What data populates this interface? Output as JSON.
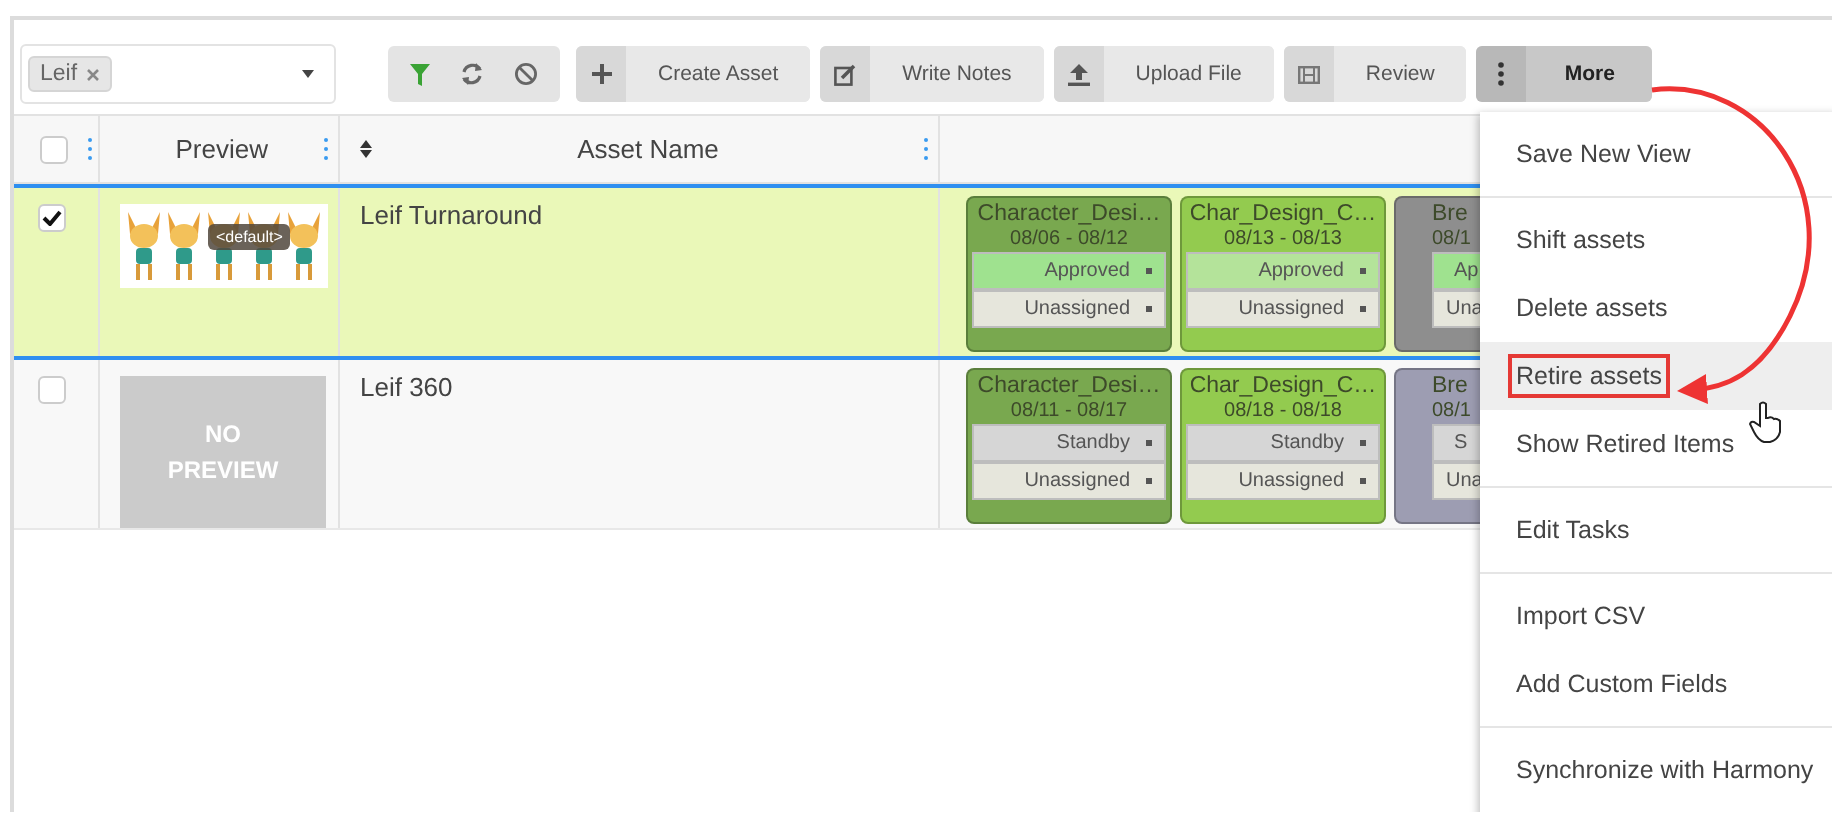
{
  "filter": {
    "tags": [
      {
        "label": "Leif"
      }
    ]
  },
  "toolbar": {
    "buttons": [
      {
        "label": "Create Asset",
        "active": false
      },
      {
        "label": "Write Notes",
        "active": false
      },
      {
        "label": "Upload File",
        "active": false
      },
      {
        "label": "Review",
        "active": false
      },
      {
        "label": "More",
        "active": true
      }
    ]
  },
  "table": {
    "header_checked": false,
    "columns": [
      {
        "label": "Preview"
      },
      {
        "label": "Asset Name"
      }
    ],
    "rows": [
      {
        "selected": true,
        "checked": true,
        "preview": {
          "kind": "picture",
          "badge": "<default>"
        },
        "name": "Leif Turnaround",
        "tasks": [
          {
            "title": "Character_Desi…",
            "dates": "08/06 - 08/12",
            "status": {
              "label": "Approved",
              "color": "#9fe28f"
            },
            "assignee": "Unassigned",
            "color": "#79a84f"
          },
          {
            "title": "Char_Design_C…",
            "dates": "08/13 - 08/13",
            "status": {
              "label": "Approved",
              "color": "#b4e39a"
            },
            "assignee": "Unassigned",
            "color": "#93cb4f"
          },
          {
            "title": "Bre",
            "dates": "08/1",
            "status": {
              "label": "Ap",
              "color": "#9fe28f"
            },
            "assignee": "Una",
            "color": "#8e8e8e"
          }
        ]
      },
      {
        "selected": false,
        "checked": false,
        "preview": {
          "kind": "none",
          "text": "NO PREVIEW"
        },
        "name": "Leif 360",
        "tasks": [
          {
            "title": "Character_Desi…",
            "dates": "08/11 - 08/17",
            "status": {
              "label": "Standby",
              "color": "#d6d6d6"
            },
            "assignee": "Unassigned",
            "color": "#79a84f"
          },
          {
            "title": "Char_Design_C…",
            "dates": "08/18 - 08/18",
            "status": {
              "label": "Standby",
              "color": "#d6d6d6"
            },
            "assignee": "Unassigned",
            "color": "#93cb4f"
          },
          {
            "title": "Bre",
            "dates": "08/1",
            "status": {
              "label": "S",
              "color": "#d6d6d6"
            },
            "assignee": "Una",
            "color": "#9d9db2"
          }
        ]
      }
    ]
  },
  "menu": {
    "groups": [
      [
        {
          "label": "Save New View",
          "hovered": false
        }
      ],
      [
        {
          "label": "Shift assets",
          "hovered": false
        },
        {
          "label": "Delete assets",
          "hovered": false
        },
        {
          "label": "Retire assets",
          "hovered": true
        },
        {
          "label": "Show Retired Items",
          "hovered": false
        }
      ],
      [
        {
          "label": "Edit Tasks",
          "hovered": false
        }
      ],
      [
        {
          "label": "Import CSV",
          "hovered": false
        },
        {
          "label": "Add Custom Fields",
          "hovered": false
        }
      ],
      [
        {
          "label": "Synchronize with Harmony",
          "hovered": false
        }
      ]
    ]
  }
}
